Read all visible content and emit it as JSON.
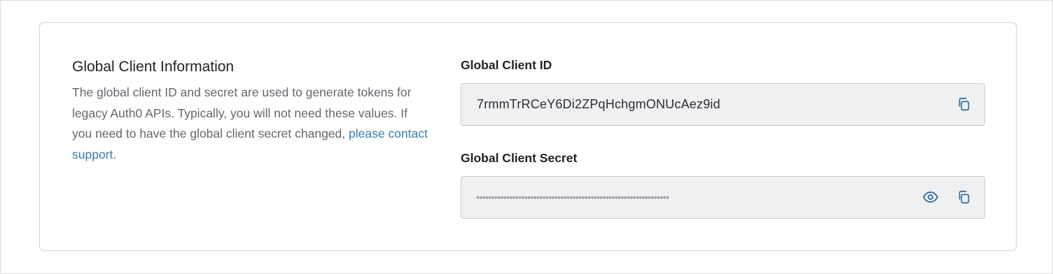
{
  "section": {
    "title": "Global Client Information",
    "description": "The global client ID and secret are used to generate tokens for legacy Auth0 APIs. Typically, you will not need these values. If you need to have the global client secret changed, ",
    "link_text": "please contact support."
  },
  "client_id": {
    "label": "Global Client ID",
    "value": "7rmmTrRCeY6Di2ZPqHchgmONUcAez9id"
  },
  "client_secret": {
    "label": "Global Client Secret",
    "masked_value": "••••••••••••••••••••••••••••••••••••••••••••••••••••••••••••••••"
  },
  "icons": {
    "copy": "copy-icon",
    "reveal": "eye-icon"
  },
  "colors": {
    "link": "#3a7ea9",
    "icon": "#2b6a99",
    "field_bg": "#eff0f1"
  }
}
